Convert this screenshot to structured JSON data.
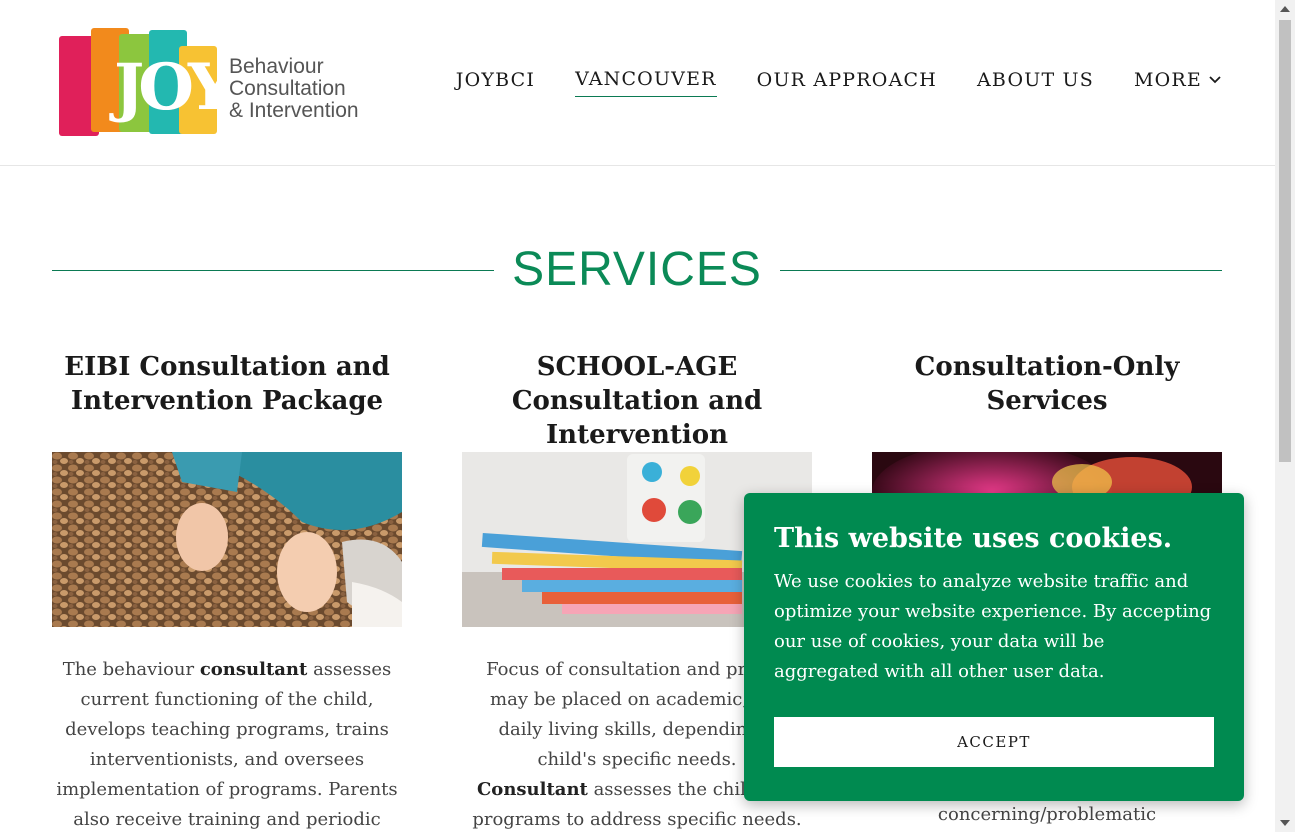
{
  "logo": {
    "mark": "JOY",
    "line1": "Behaviour",
    "line2": "Consultation",
    "line3": "& Intervention"
  },
  "nav": {
    "items": [
      {
        "label": "JOYBCI"
      },
      {
        "label": "VANCOUVER"
      },
      {
        "label": "OUR APPROACH"
      },
      {
        "label": "ABOUT US"
      },
      {
        "label": "MORE"
      }
    ]
  },
  "services": {
    "title": "SERVICES",
    "columns": [
      {
        "title": "EIBI Consultation and Intervention Package",
        "text_before": "The behaviour ",
        "text_bold": "consultant",
        "text_after": " assesses current functioning of the child, develops teaching programs, trains interventionists, and oversees implementation of programs. Parents also receive training and periodic progress"
      },
      {
        "title": "SCHOOL-AGE Consultation and Intervention",
        "text_before": "Focus of consultation and progra",
        "text_line2": "may be placed on academic, soc",
        "text_line3": "daily living skills, depending o",
        "text_line4": "child's specific needs.",
        "text_bold": "Consultant",
        "text_after": " assesses the child and",
        "text_line6": "programs to address specific needs."
      },
      {
        "title": "Consultation-Only Services",
        "text_visible": "concerning/problematic"
      }
    ]
  },
  "cookie": {
    "title": "This website uses cookies.",
    "text": "We use cookies to analyze website traffic and optimize your website experience. By accepting our use of cookies, your data will be aggregated with all other user data.",
    "accept_label": "ACCEPT"
  },
  "colors": {
    "brand_green": "#008a50",
    "accent_green": "#0b7a53"
  }
}
